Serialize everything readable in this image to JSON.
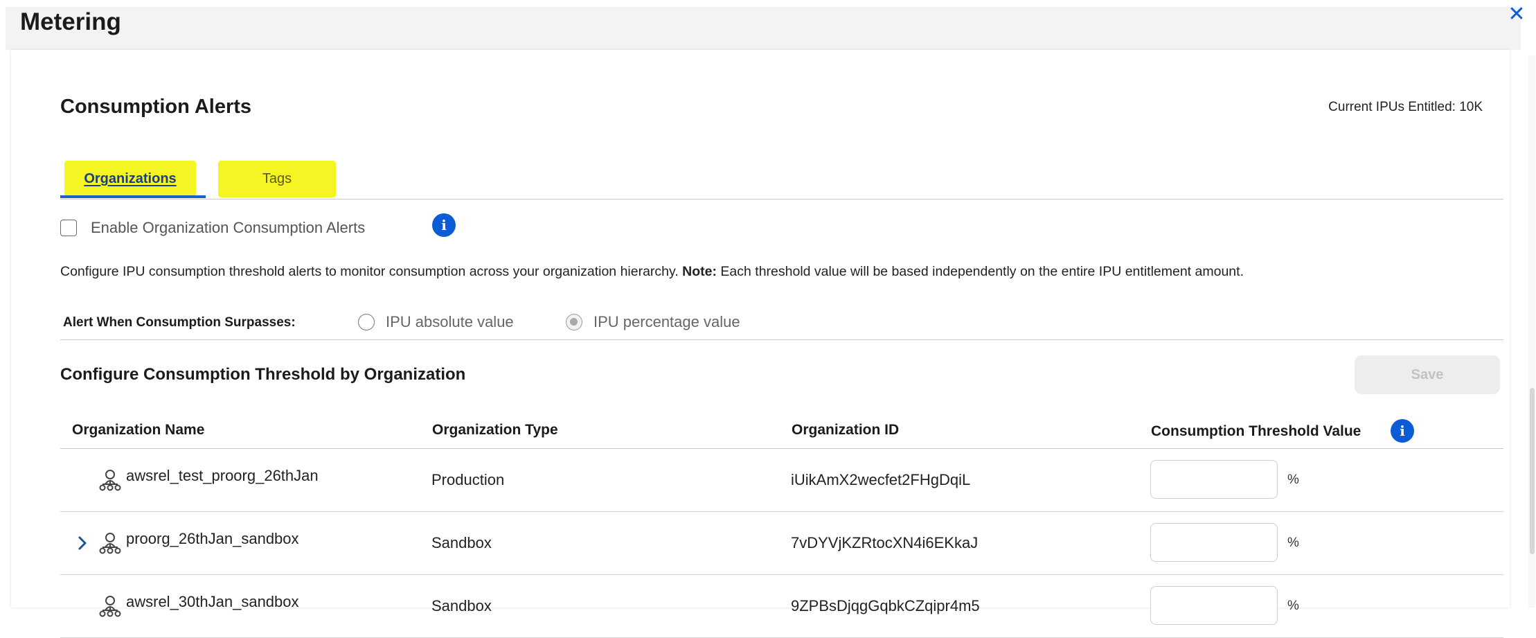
{
  "app": {
    "title": "Metering",
    "close_icon": "close-icon"
  },
  "panel": {
    "title": "Consumption Alerts",
    "entitled": "Current IPUs Entitled: 10K"
  },
  "tabs": [
    {
      "label": "Organizations",
      "active": true
    },
    {
      "label": "Tags",
      "active": false
    }
  ],
  "enable_alerts": {
    "label": "Enable Organization Consumption Alerts",
    "checked": false
  },
  "description": {
    "text": "Configure IPU consumption threshold alerts to monitor consumption across your organization hierarchy.",
    "note_label": "Note:",
    "note_text": "Each threshold value will be based independently on the entire IPU entitlement amount."
  },
  "alert_when": {
    "label": "Alert When Consumption Surpasses:",
    "options": [
      {
        "label": "IPU absolute value",
        "selected": false
      },
      {
        "label": "IPU percentage value",
        "selected": true
      }
    ]
  },
  "config": {
    "title": "Configure Consumption Threshold by Organization",
    "save_label": "Save"
  },
  "table": {
    "columns": [
      "Organization Name",
      "Organization Type",
      "Organization ID",
      "Consumption Threshold Value"
    ],
    "unit": "%",
    "rows": [
      {
        "name": "awsrel_test_proorg_26thJan",
        "type": "Production",
        "id": "iUikAmX2wecfet2FHgDqiL",
        "threshold": "",
        "expandable": false
      },
      {
        "name": "proorg_26thJan_sandbox",
        "type": "Sandbox",
        "id": "7vDYVjKZRtocXN4i6EKkaJ",
        "threshold": "",
        "expandable": true
      },
      {
        "name": "awsrel_30thJan_sandbox",
        "type": "Sandbox",
        "id": "9ZPBsDjqgGqbkCZqipr4m5",
        "threshold": "",
        "expandable": false
      }
    ]
  },
  "colors": {
    "accent": "#0b5cd5",
    "tab_highlight": "#f5f523"
  }
}
